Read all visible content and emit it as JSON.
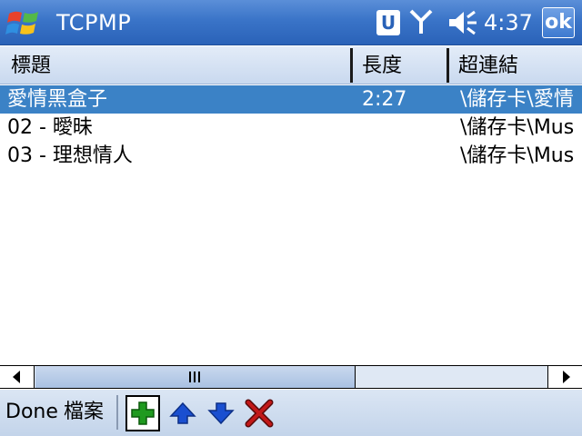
{
  "titlebar": {
    "app_title": "TCPMP",
    "u_badge": "U",
    "clock": "4:37",
    "ok_label": "ok"
  },
  "columns": [
    "標題",
    "長度",
    "超連結"
  ],
  "rows": [
    {
      "title": "愛情黑盒子",
      "length": "2:27",
      "link": "\\儲存卡\\愛情",
      "selected": true
    },
    {
      "title": "02 - 曖昧",
      "length": "",
      "link": "\\儲存卡\\Mus",
      "selected": false
    },
    {
      "title": "03 - 理想情人",
      "length": "",
      "link": "\\儲存卡\\Mus",
      "selected": false
    }
  ],
  "toolbar": {
    "done_label": "Done",
    "file_label": "檔案"
  },
  "icons": {
    "start": "windows-flag-icon",
    "signal": "antenna-icon",
    "volume": "speaker-icon",
    "add": "plus-icon",
    "up": "arrow-up-icon",
    "down": "arrow-down-icon",
    "delete": "x-icon"
  },
  "colors": {
    "titlebar": "#3a74c8",
    "selection": "#3b82c6",
    "add_icon": "#1f9a1f",
    "arrow_icon": "#1a4fd0",
    "delete_icon": "#c21818"
  }
}
